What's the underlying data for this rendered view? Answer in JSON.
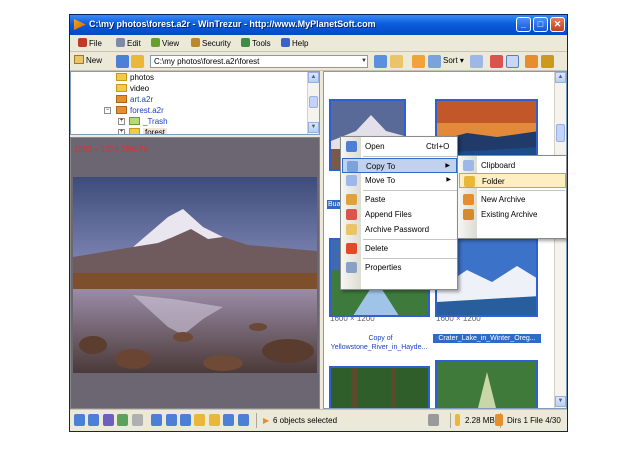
{
  "window": {
    "title": "C:\\my photos\\forest.a2r - WinTrezur - http://www.MyPlanetSoft.com",
    "minimize_glyph": "_",
    "maximize_glyph": "□",
    "close_glyph": "✕"
  },
  "menu": [
    {
      "label": "File",
      "icon": "file-icon",
      "color": "#c0392b"
    },
    {
      "label": "Edit",
      "icon": "edit-icon",
      "color": "#7d8ba8"
    },
    {
      "label": "View",
      "icon": "view-icon",
      "color": "#6a9e2f"
    },
    {
      "label": "Security",
      "icon": "security-icon",
      "color": "#b9892c"
    },
    {
      "label": "Tools",
      "icon": "tools-icon",
      "color": "#3e8e41"
    },
    {
      "label": "Help",
      "icon": "help-icon",
      "color": "#3a63c9"
    }
  ],
  "toolbar": {
    "new_label": "New",
    "path_value": "C:\\my photos\\forest.a2r\\forest",
    "sort_label": "Sort"
  },
  "tree": {
    "items": [
      {
        "label": "photos",
        "name": "tree-item-photos"
      },
      {
        "label": "video",
        "name": "tree-item-video"
      },
      {
        "label": "art.a2r",
        "name": "tree-item-art"
      },
      {
        "label": "forest.a2r",
        "name": "tree-item-forest-archive"
      },
      {
        "label": "_Trash",
        "name": "tree-item-trash"
      },
      {
        "label": "forest",
        "name": "tree-item-forest"
      }
    ],
    "expand_glyph": "+",
    "collapse_glyph": "−"
  },
  "preview": {
    "info_text": "1280 × 1024 28% Fit"
  },
  "thumbnails": [
    {
      "dims": "",
      "caption": "Buac",
      "selected": true
    },
    {
      "dims": "",
      "caption": "",
      "selected": false
    },
    {
      "dims": "1600 × 1200",
      "caption_line1": "Copy of",
      "caption_line2": "Yellowstone_River_in_Hayde...",
      "selected": false
    },
    {
      "dims": "1600 × 1200",
      "caption": "Crater_Lake_in_Winter_Oreg...",
      "selected": true
    }
  ],
  "context_menu": {
    "open": "Open",
    "open_shortcut": "Ctrl+O",
    "copy_to": "Copy To",
    "move_to": "Move To",
    "paste": "Paste",
    "append_files": "Append Files",
    "archive_password": "Archive Password",
    "delete": "Delete",
    "properties": "Properties",
    "arrow": "▶"
  },
  "submenu": {
    "clipboard": "Clipboard",
    "folder": "Folder",
    "new_archive": "New Archive",
    "existing_archive": "Existing Archive"
  },
  "statusbar": {
    "selection_text": "6 objects selected",
    "size_text": "2.28 MB",
    "dirs_files_text": "Dirs 1 File 4/30"
  },
  "colors": {
    "selection_blue": "#316ac5",
    "highlight_blue": "#c1d2ee",
    "submenu_highlight": "#ffeec2"
  }
}
